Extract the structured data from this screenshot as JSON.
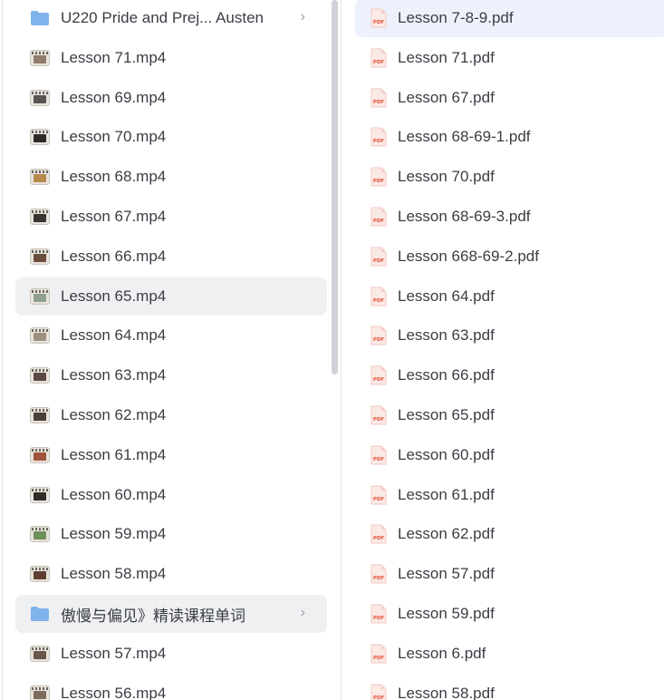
{
  "left_list": [
    {
      "type": "folder",
      "label": "U220 Pride and Prej...  Austen",
      "chevron": "›"
    },
    {
      "type": "video",
      "label": "Lesson 71.mp4",
      "thumb_color": "#8f7c6b"
    },
    {
      "type": "video",
      "label": "Lesson 69.mp4",
      "thumb_color": "#5a5552"
    },
    {
      "type": "video",
      "label": "Lesson 70.mp4",
      "thumb_color": "#2f2a27"
    },
    {
      "type": "video",
      "label": "Lesson 68.mp4",
      "thumb_color": "#b7894f"
    },
    {
      "type": "video",
      "label": "Lesson 67.mp4",
      "thumb_color": "#3b3532"
    },
    {
      "type": "video",
      "label": "Lesson 66.mp4",
      "thumb_color": "#6b4e3c"
    },
    {
      "type": "video",
      "label": "Lesson 65.mp4",
      "thumb_color": "#8ea08f"
    },
    {
      "type": "video",
      "label": "Lesson 64.mp4",
      "thumb_color": "#9e8f7f"
    },
    {
      "type": "video",
      "label": "Lesson 63.mp4",
      "thumb_color": "#5b4a42"
    },
    {
      "type": "video",
      "label": "Lesson 62.mp4",
      "thumb_color": "#4a403c"
    },
    {
      "type": "video",
      "label": "Lesson 61.mp4",
      "thumb_color": "#a0523d"
    },
    {
      "type": "video",
      "label": "Lesson 60.mp4",
      "thumb_color": "#332d2a"
    },
    {
      "type": "video",
      "label": "Lesson 59.mp4",
      "thumb_color": "#6e8e5a"
    },
    {
      "type": "video",
      "label": "Lesson 58.mp4",
      "thumb_color": "#5e4032"
    },
    {
      "type": "folder",
      "label": "傲慢与偏见》精读课程单词",
      "chevron": "›"
    },
    {
      "type": "video",
      "label": "Lesson 57.mp4",
      "thumb_color": "#6a5748"
    },
    {
      "type": "video",
      "label": "Lesson 56.mp4",
      "thumb_color": "#7d6b5c"
    }
  ],
  "right_list": [
    {
      "label": "Lesson 7-8-9.pdf"
    },
    {
      "label": "Lesson 71.pdf"
    },
    {
      "label": "Lesson 67.pdf"
    },
    {
      "label": "Lesson 68-69-1.pdf"
    },
    {
      "label": "Lesson 70.pdf"
    },
    {
      "label": "Lesson 68-69-3.pdf"
    },
    {
      "label": "Lesson 668-69-2.pdf"
    },
    {
      "label": "Lesson 64.pdf"
    },
    {
      "label": "Lesson 63.pdf"
    },
    {
      "label": "Lesson 66.pdf"
    },
    {
      "label": "Lesson 65.pdf"
    },
    {
      "label": "Lesson 60.pdf"
    },
    {
      "label": "Lesson 61.pdf"
    },
    {
      "label": "Lesson 62.pdf"
    },
    {
      "label": "Lesson 57.pdf"
    },
    {
      "label": "Lesson 59.pdf"
    },
    {
      "label": "Lesson 6.pdf"
    },
    {
      "label": "Lesson 58.pdf"
    }
  ],
  "pdf_icon_text": "PDF",
  "colors": {
    "folder": "#7fb3ec",
    "pdf_red": "#e5533d",
    "hover_bg": "#eff0f2",
    "selected_bg": "#edf1fc"
  }
}
